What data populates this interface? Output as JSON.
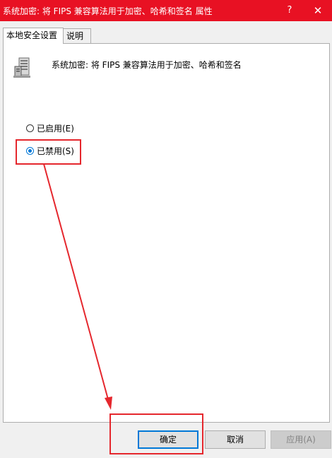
{
  "window": {
    "title": "系统加密: 将 FIPS 兼容算法用于加密、哈希和签名 属性",
    "help_label": "?",
    "close_label": "✕"
  },
  "tabs": [
    {
      "label": "本地安全设置",
      "active": true
    },
    {
      "label": "说明",
      "active": false
    }
  ],
  "policy": {
    "icon": "server-policy-icon",
    "name": "系统加密: 将 FIPS 兼容算法用于加密、哈希和签名"
  },
  "options": [
    {
      "label": "已启用(E)",
      "checked": false
    },
    {
      "label": "已禁用(S)",
      "checked": true
    }
  ],
  "buttons": {
    "ok": "确定",
    "cancel": "取消",
    "apply": "应用(A)"
  },
  "colors": {
    "titlebar": "#e81123",
    "annotation": "#e5272d",
    "accent": "#0078d7"
  }
}
